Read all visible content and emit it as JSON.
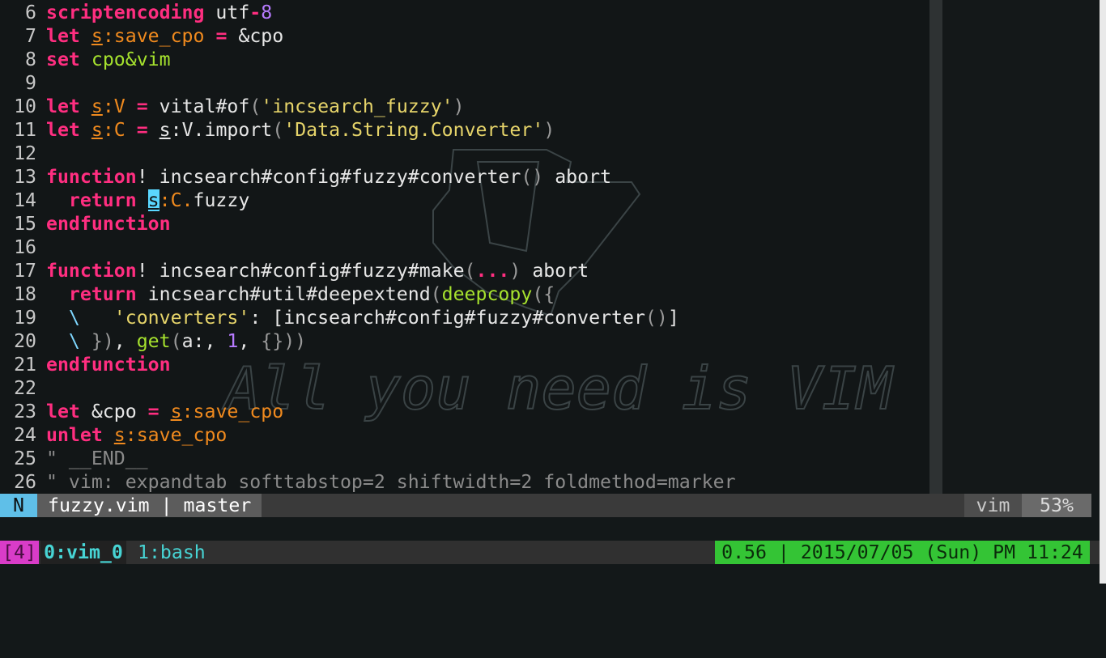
{
  "editor": {
    "lines": [
      {
        "n": "6",
        "html": "<span class='kw'>scriptencoding</span> utf<span class='kw'>-</span><span class='num'>8</span>"
      },
      {
        "n": "7",
        "html": "<span class='kw'>let</span> <span class='sc'>s</span><span class='og'>:save_cpo</span> <span class='kw'>=</span> &amp;cpo"
      },
      {
        "n": "8",
        "html": "<span class='kw'>set</span> <span class='gr'>cpo&amp;vim</span>"
      },
      {
        "n": "9",
        "html": ""
      },
      {
        "n": "10",
        "html": "<span class='kw'>let</span> <span class='sc'>s</span><span class='og'>:V</span> <span class='kw'>=</span> vital#of<span class='dim'>(</span><span class='str'>'incsearch_fuzzy'</span><span class='dim'>)</span>"
      },
      {
        "n": "11",
        "html": "<span class='kw'>let</span> <span class='sc'>s</span><span class='og'>:C</span> <span class='kw'>=</span> <span style='text-decoration:underline'>s</span>:V.import<span class='dim'>(</span><span class='str'>'Data.String.Converter'</span><span class='dim'>)</span>"
      },
      {
        "n": "12",
        "html": ""
      },
      {
        "n": "13",
        "html": "<span class='kw'>function</span>! incsearch#config#fuzzy#converter<span class='dim'>()</span> abort"
      },
      {
        "n": "14",
        "html": "  <span class='kw'>return</span> <span class='cursor'>s</span><span class='og'>:C.</span>fuzzy"
      },
      {
        "n": "15",
        "html": "<span class='kw'>endfunction</span>"
      },
      {
        "n": "16",
        "html": ""
      },
      {
        "n": "17",
        "html": "<span class='kw'>function</span>! incsearch#config#fuzzy#make<span class='dim'>(</span><span class='kw'>...</span><span class='dim'>)</span> abort"
      },
      {
        "n": "18",
        "html": "  <span class='kw'>return</span> incsearch#util#deepextend<span class='dim'>(</span><span class='gr'>deepcopy</span><span class='dim'>({</span>"
      },
      {
        "n": "19",
        "html": "  <span class='cy'>\\</span>   <span class='str'>'converters'</span>: [incsearch#config#fuzzy#converter<span class='dim'>()</span>]"
      },
      {
        "n": "20",
        "html": "  <span class='cy'>\\</span> <span class='dim'>})</span>, <span class='gr'>get</span><span class='dim'>(</span>a:, <span class='num'>1</span>, <span class='dim'>{}))</span>"
      },
      {
        "n": "21",
        "html": "<span class='kw'>endfunction</span>"
      },
      {
        "n": "22",
        "html": ""
      },
      {
        "n": "23",
        "html": "<span class='kw'>let</span> &amp;cpo <span class='kw'>=</span> <span class='sc'>s</span><span class='og'>:save_cpo</span>"
      },
      {
        "n": "24",
        "html": "<span class='kw'>unlet</span> <span class='sc'>s</span><span class='og'>:save_cpo</span>"
      },
      {
        "n": "25",
        "html": "<span class='cm'>\" __END__</span>"
      },
      {
        "n": "26",
        "html": "<span class='cm'>\" vim: expandtab softtabstop=2 shiftwidth=2 foldmethod=marker</span>"
      }
    ],
    "background_text": "All you need is VIM"
  },
  "statusline": {
    "mode": "N",
    "file": "fuzzy.vim | master",
    "filetype": "vim",
    "percent": "53%"
  },
  "tmux": {
    "session": "[4]",
    "active_window": "0:vim_0",
    "window": "1:bash",
    "status": "0.56 | 2015/07/05 (Sun) PM 11:24"
  },
  "colors": {
    "keyword": "#ff2e80",
    "orange": "#f08a1e",
    "string": "#e6d46a",
    "green": "#a6e22e",
    "purple": "#b77bff",
    "mode_blue": "#5fbfe8",
    "tmux_green": "#34c435",
    "tmux_magenta": "#d93cc8"
  }
}
